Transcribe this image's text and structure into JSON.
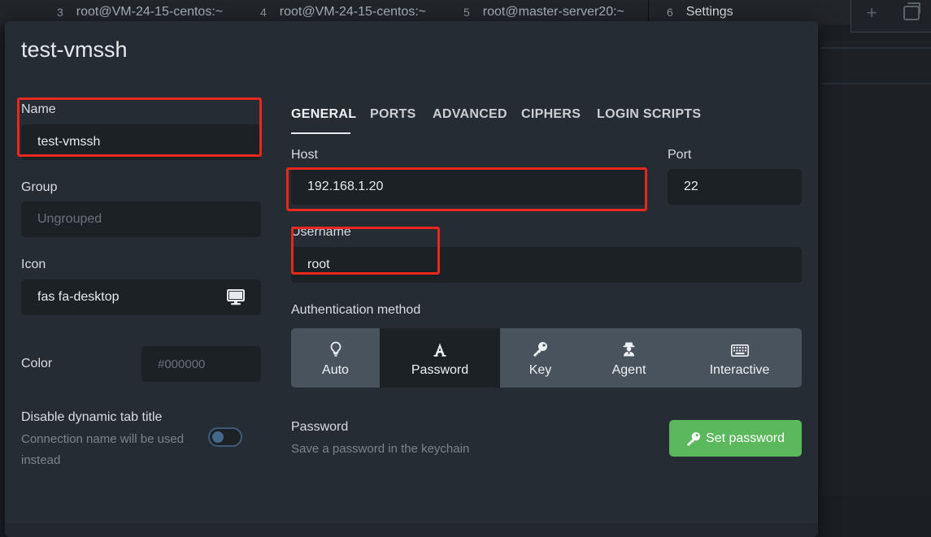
{
  "tabs": [
    {
      "num": "3",
      "label": "root@VM-24-15-centos:~"
    },
    {
      "num": "4",
      "label": "root@VM-24-15-centos:~"
    },
    {
      "num": "5",
      "label": "root@master-server20:~"
    },
    {
      "num": "6",
      "label": "Settings"
    }
  ],
  "dialog": {
    "title": "test-vmssh",
    "left": {
      "name_label": "Name",
      "name_value": "test-vmssh",
      "group_label": "Group",
      "group_placeholder": "Ungrouped",
      "icon_label": "Icon",
      "icon_value": "fas fa-desktop",
      "icon_glyph": "desktop-icon",
      "color_label": "Color",
      "color_placeholder": "#000000",
      "dyn_title_label": "Disable dynamic tab title",
      "dyn_title_hint_1": "Connection name will be used",
      "dyn_title_hint_2": "instead",
      "dyn_title_enabled": false
    },
    "nav_tabs": [
      "GENERAL",
      "PORTS",
      "ADVANCED",
      "CIPHERS",
      "LOGIN SCRIPTS"
    ],
    "active_tab": "GENERAL",
    "general": {
      "host_label": "Host",
      "host_value": "192.168.1.20",
      "port_label": "Port",
      "port_value": "22",
      "username_label": "Username",
      "username_value": "root",
      "auth_label": "Authentication method",
      "auth_methods": [
        {
          "label": "Auto",
          "icon": "lightbulb-icon"
        },
        {
          "label": "Password",
          "icon": "font-a-icon"
        },
        {
          "label": "Key",
          "icon": "key-icon"
        },
        {
          "label": "Agent",
          "icon": "user-secret-icon"
        },
        {
          "label": "Interactive",
          "icon": "keyboard-icon"
        }
      ],
      "auth_selected": "Password",
      "password_label": "Password",
      "password_hint": "Save a password in the keychain",
      "set_password_label": "Set password"
    }
  },
  "colors": {
    "accent_green": "#5cb85c",
    "highlight_red": "#e8271d",
    "dialog_bg": "#262c33",
    "input_bg": "#1c2126"
  }
}
